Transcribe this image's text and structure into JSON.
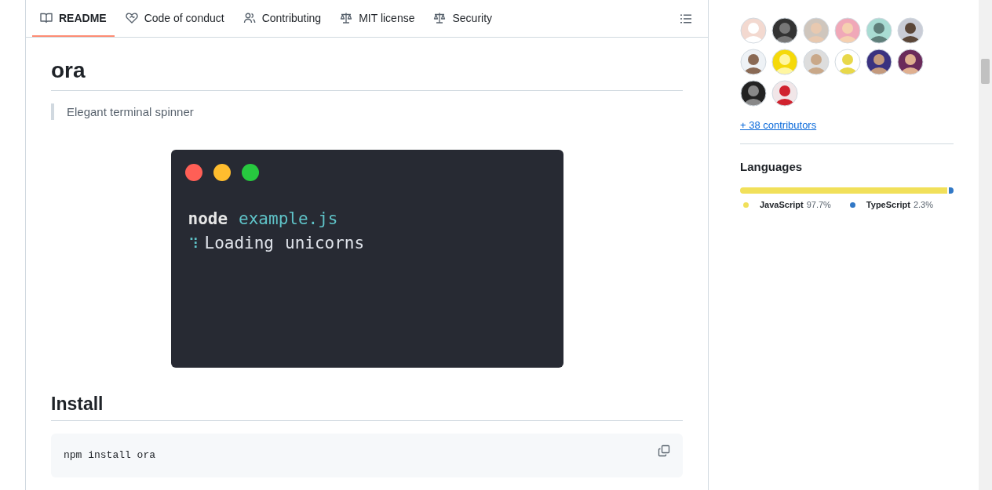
{
  "tabs": [
    {
      "label": "README",
      "kind": "book",
      "selected": true
    },
    {
      "label": "Code of conduct",
      "kind": "heart",
      "selected": false
    },
    {
      "label": "Contributing",
      "kind": "people",
      "selected": false
    },
    {
      "label": "MIT license",
      "kind": "scale",
      "selected": false
    },
    {
      "label": "Security",
      "kind": "scale",
      "selected": false
    }
  ],
  "readme": {
    "title": "ora",
    "quote": "Elegant terminal spinner",
    "terminal": {
      "lines": [
        [
          {
            "text": "node",
            "kind": "command"
          },
          {
            "text": "example.js",
            "kind": "arg"
          }
        ],
        [
          {
            "text": "⠹",
            "kind": "spinner"
          },
          {
            "text": "Loading",
            "kind": "plain"
          },
          {
            "text": "unicorns",
            "kind": "plain"
          }
        ]
      ]
    },
    "install_heading": "Install",
    "install_code": "npm install ora"
  },
  "sidebar": {
    "more_link": "+ 38 contributors",
    "languages_title": "Languages",
    "languages": [
      {
        "name": "JavaScript",
        "percent": "97.7%",
        "level": 0.977,
        "color": "#f1e05a"
      },
      {
        "name": "TypeScript",
        "percent": "2.3%",
        "level": 0.023,
        "color": "#3178c6"
      }
    ]
  }
}
